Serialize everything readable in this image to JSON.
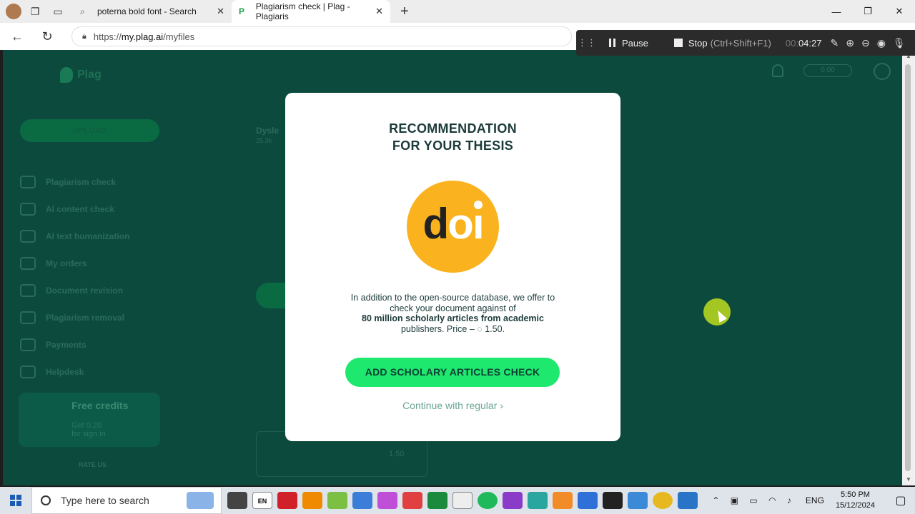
{
  "browser": {
    "tabs": [
      {
        "title": "poterna bold font - Search",
        "icon": "search-icon"
      },
      {
        "title": "Plagiarism check | Plag - Plagiaris",
        "icon": "plag-logo-icon"
      }
    ],
    "url_prefix": "https://",
    "url_domain": "my.plag.ai",
    "url_path": "/myfiles"
  },
  "recorder": {
    "pause_label": "Pause",
    "stop_label": "Stop",
    "stop_hint": "(Ctrl+Shift+F1)",
    "time_dim": "00:",
    "time": "04:27"
  },
  "app": {
    "logo": "Plag",
    "upload_label": "UPLOAD",
    "balance": "0.00",
    "sidebar": [
      {
        "label": "Plagiarism check",
        "icon": "document-icon"
      },
      {
        "label": "AI content check",
        "icon": "robot-icon"
      },
      {
        "label": "AI text humanization",
        "icon": "location-icon"
      },
      {
        "label": "My orders",
        "icon": "list-icon"
      },
      {
        "label": "Document revision",
        "icon": "pen-icon"
      },
      {
        "label": "Plagiarism removal",
        "icon": "eraser-icon"
      },
      {
        "label": "Payments",
        "icon": "payments-icon"
      },
      {
        "label": "Helpdesk",
        "icon": "helpdesk-icon"
      }
    ],
    "credits": {
      "title": "Free credits",
      "line1": "Get 0.20",
      "line2": "for sign in"
    },
    "rate_us": "RATE US",
    "bg_file": {
      "name": "Dysle",
      "meta": "25.3k"
    },
    "bg_price": "1.50"
  },
  "modal": {
    "title_line1": "RECOMMENDATION",
    "title_line2": "FOR YOUR THESIS",
    "logo_text": "doi",
    "desc_part1": "In addition to the open-source database, we offer to check your document against of",
    "desc_bold": "80 million scholarly articles from academic",
    "desc_part2": "publishers. Price –",
    "price": "1.50.",
    "cta_label": "ADD SCHOLARY ARTICLES CHECK",
    "continue_label": "Continue with regular"
  },
  "taskbar": {
    "search_placeholder": "Type here to search",
    "lang": "ENG",
    "lang_badge": "EN",
    "time": "5:50 PM",
    "date": "15/12/2024"
  },
  "colors": {
    "overlay_bg": "#0d4a3e",
    "cta_green": "#1ee86e",
    "doi_yellow": "#fab21e",
    "title_dark": "#1c3a3a"
  }
}
